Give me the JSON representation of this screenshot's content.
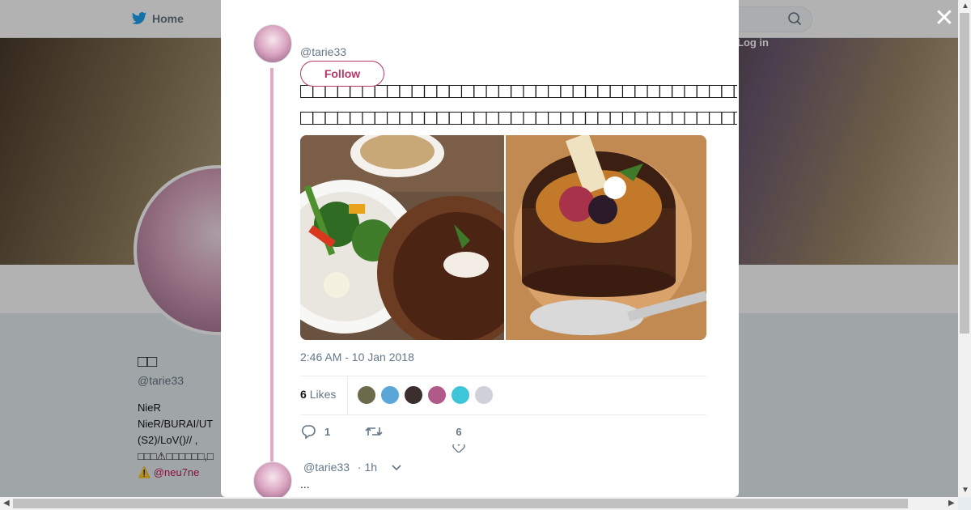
{
  "nav": {
    "home_label": "Home",
    "login_label": "Log in"
  },
  "profile": {
    "name": "□□",
    "handle": "@tarie33",
    "bio_lines": [
      "NieR",
      " NieR/BURAI/UT",
      "(S2)/LoV()// ,",
      "□□□⚠□□□□□□,□",
      "⚠️    @neu7ne"
    ]
  },
  "tweet": {
    "handle": "@tarie33",
    "follow_label": "Follow",
    "text_lines": [
      "□□□□□□□□□□□□□□□□□□□□□□□□□□□□□□□□□□□□□□□□□□□□□□□□□□□□□□□□□□□□□□□□□□□□…",
      "□□□□□□□□□□□□□□□□□□□□□□□□□□□□□□□□□□□□□□□□□□□□□□□□□□□□□□□□□□□□□□□ □□□□..."
    ],
    "timestamp": "2:46 AM - 10 Jan 2018",
    "likes_count": "6",
    "likes_label": "Likes",
    "reply_count": "1",
    "like_count_action": "6",
    "liker_colors": [
      "#6b6a4a",
      "#5aa6d6",
      "#3a2e2e",
      "#b05a8a",
      "#3ec6d8",
      "#d0d0d8"
    ]
  },
  "reply": {
    "handle": "@tarie33",
    "time": "· 1h",
    "text": "..."
  },
  "colors": {
    "accent": "#b5386b",
    "thread": "#e3a8c2"
  }
}
